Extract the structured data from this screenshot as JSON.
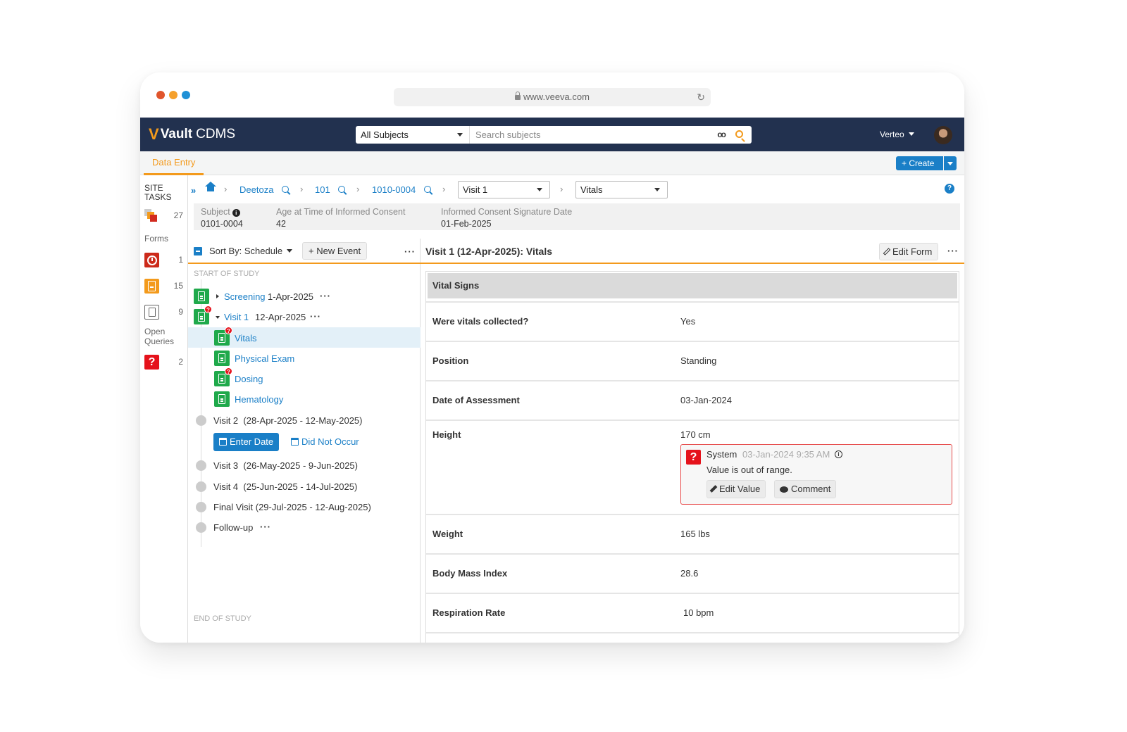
{
  "browser": {
    "url": "www.veeva.com"
  },
  "header": {
    "app_name_bold": "Vault",
    "app_name_rest": "CDMS",
    "scope_select": "All Subjects",
    "search_placeholder": "Search subjects",
    "user": "Verteo",
    "binoculars_glyph": "oo"
  },
  "subnav": {
    "active_tab": "Data Entry",
    "create_label": "Create"
  },
  "site_tasks": {
    "title_line1": "SITE",
    "title_line2": "TASKS",
    "tasks_count": "27",
    "forms_label": "Forms",
    "forms": [
      {
        "icon": "clock-icon",
        "count": "1",
        "color": "#cc2a1a"
      },
      {
        "icon": "form-icon",
        "count": "15",
        "color": "#f39a1c"
      },
      {
        "icon": "blank-form-icon",
        "count": "9",
        "color": "#666666"
      }
    ],
    "queries_label_line1": "Open",
    "queries_label_line2": "Queries",
    "queries_count": "2",
    "query_glyph": "?"
  },
  "breadcrumb": {
    "expand_glyph": "»",
    "sep": "›",
    "study": "Deetoza",
    "site": "101",
    "subject": "1010-0004",
    "event_select": "Visit 1",
    "form_select": "Vitals",
    "help_glyph": "?"
  },
  "subject_bar": {
    "fields": [
      {
        "label": "Subject",
        "value": "0101-0004"
      },
      {
        "label": "Age at Time of Informed Consent",
        "value": "42"
      },
      {
        "label": "Informed Consent Signature Date",
        "value": "01-Feb-2025"
      }
    ],
    "info_glyph": "i"
  },
  "schedule": {
    "sort_label": "Sort By: Schedule",
    "new_event_label": "+ New Event",
    "more_glyph": "···",
    "start_caption": "START OF STUDY",
    "end_caption": "END OF STUDY",
    "events": [
      {
        "name": "Screening",
        "date": "1-Apr-2025"
      },
      {
        "name": "Visit 1",
        "date": "12-Apr-2025"
      }
    ],
    "forms": [
      {
        "name": "Vitals",
        "has_query": true,
        "selected": true
      },
      {
        "name": "Physical Exam",
        "has_query": false
      },
      {
        "name": "Dosing",
        "has_query": true
      },
      {
        "name": "Hematology",
        "has_query": false
      }
    ],
    "future_events": [
      {
        "name": "Visit 2",
        "window": "(28-Apr-2025 - 12-May-2025)"
      },
      {
        "name": "Visit 3",
        "window": "(26-May-2025 - 9-Jun-2025)"
      },
      {
        "name": "Visit 4",
        "window": "(25-Jun-2025 - 14-Jul-2025)"
      },
      {
        "name": "Final Visit",
        "window": "(29-Jul-2025 - 12-Aug-2025)"
      },
      {
        "name": "Follow-up",
        "window": ""
      }
    ],
    "enter_date_label": "Enter Date",
    "did_not_occur_label": "Did Not Occur",
    "query_badge_glyph": "?"
  },
  "form": {
    "title": "Visit 1 (12-Apr-2025): Vitals",
    "edit_form_label": "Edit Form",
    "section": "Vital Signs",
    "rows": [
      {
        "label": "Were vitals collected?",
        "value": "Yes"
      },
      {
        "label": "Position",
        "value": "Standing"
      },
      {
        "label": "Date of Assessment",
        "value": "03-Jan-2024"
      },
      {
        "label": "Height",
        "value": "170 cm"
      },
      {
        "label": "Weight",
        "value": "165 lbs"
      },
      {
        "label": "Body Mass Index",
        "value": "28.6"
      },
      {
        "label": "Respiration Rate",
        "value": "10 bpm"
      }
    ],
    "query": {
      "author": "System",
      "timestamp": "03-Jan-2024 9:35 AM",
      "message": "Value is out of range.",
      "edit_value_label": "Edit Value",
      "comment_label": "Comment",
      "glyph": "?",
      "info_glyph": "i"
    }
  },
  "colors": {
    "nav_bg": "#22314f",
    "accent_orange": "#f39a1c",
    "link_blue": "#1a7fc7",
    "form_green": "#1fa94b",
    "query_red": "#e5121b"
  }
}
